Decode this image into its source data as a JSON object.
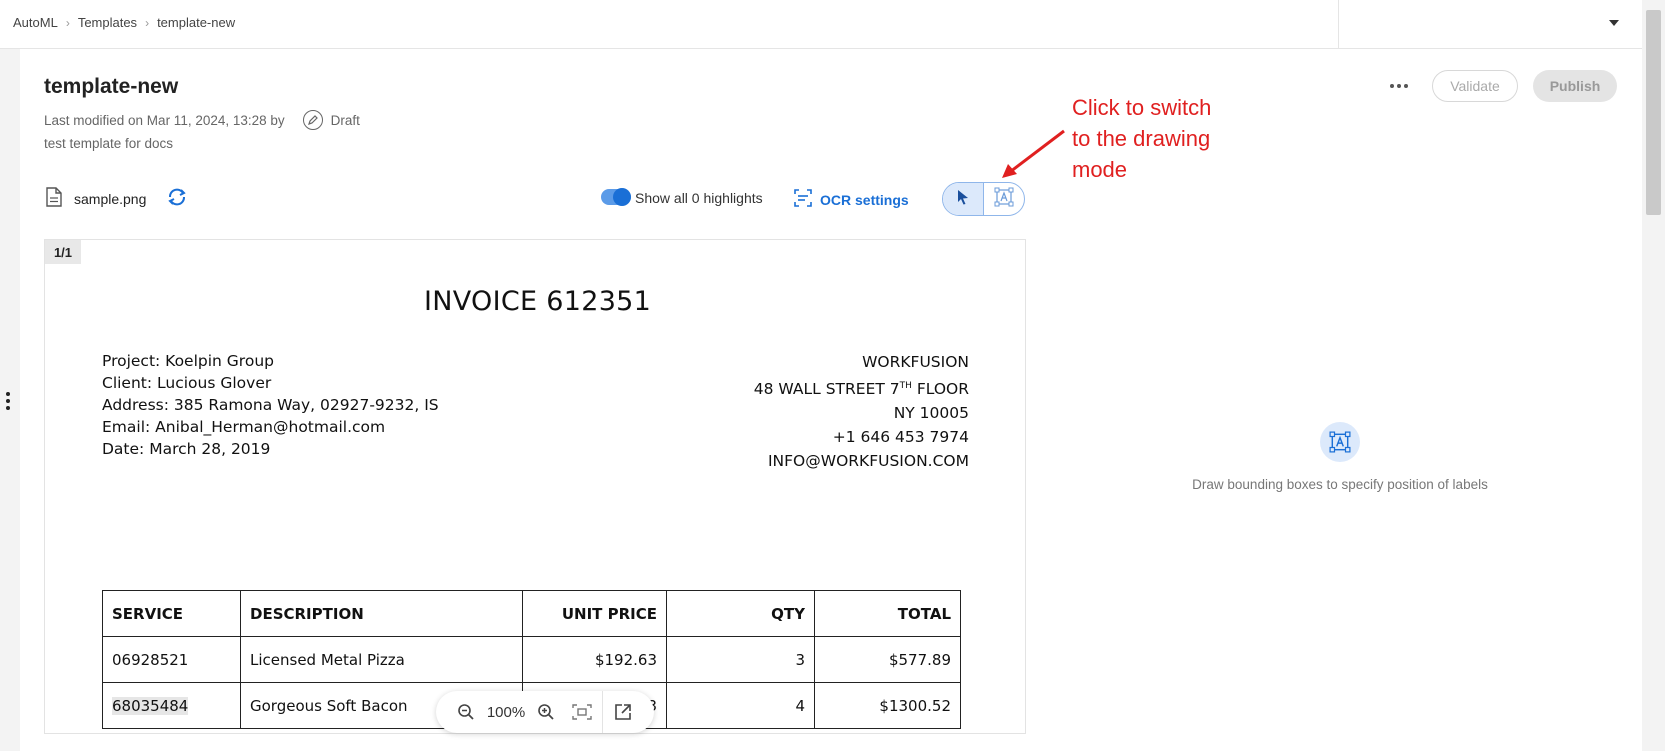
{
  "breadcrumb": {
    "items": [
      "AutoML",
      "Templates",
      "template-new"
    ]
  },
  "header": {
    "title": "template-new",
    "last_modified": "Last modified on Mar 11, 2024, 13:28 by",
    "status": "Draft",
    "description": "test template for docs",
    "validate_label": "Validate",
    "publish_label": "Publish"
  },
  "toolbar": {
    "file_name": "sample.png",
    "highlights_label": "Show all 0 highlights",
    "highlights_on": true,
    "ocr_label": "OCR settings"
  },
  "annotation": {
    "lines": [
      "Click to switch",
      "to the drawing",
      "mode"
    ]
  },
  "document": {
    "page": "1/1",
    "title": "INVOICE 612351",
    "left_lines": [
      "Project: Koelpin Group",
      "Client: Lucious Glover",
      "Address: 385 Ramona Way, 02927-9232, IS",
      "Email: Anibal_Herman@hotmail.com",
      "Date: March 28, 2019"
    ],
    "right_lines": [
      "WORKFUSION",
      "48 WALL STREET 7",
      "TH",
      " FLOOR",
      "NY 10005",
      "+1 646 453 7974",
      "INFO@WORKFUSION.COM"
    ],
    "table": {
      "headers": [
        "SERVICE",
        "DESCRIPTION",
        "UNIT PRICE",
        "QTY",
        "TOTAL"
      ],
      "rows": [
        [
          "06928521",
          "Licensed Metal Pizza",
          "$192.63",
          "3",
          "$577.89"
        ],
        [
          "68035484",
          "Gorgeous Soft Bacon",
          "3",
          "4",
          "$1300.52"
        ]
      ]
    }
  },
  "zoom": {
    "value": "100%"
  },
  "empty_state": {
    "text": "Draw bounding boxes to specify position of labels"
  },
  "colors": {
    "accent": "#1a6fd6",
    "annotation": "#e02020"
  }
}
